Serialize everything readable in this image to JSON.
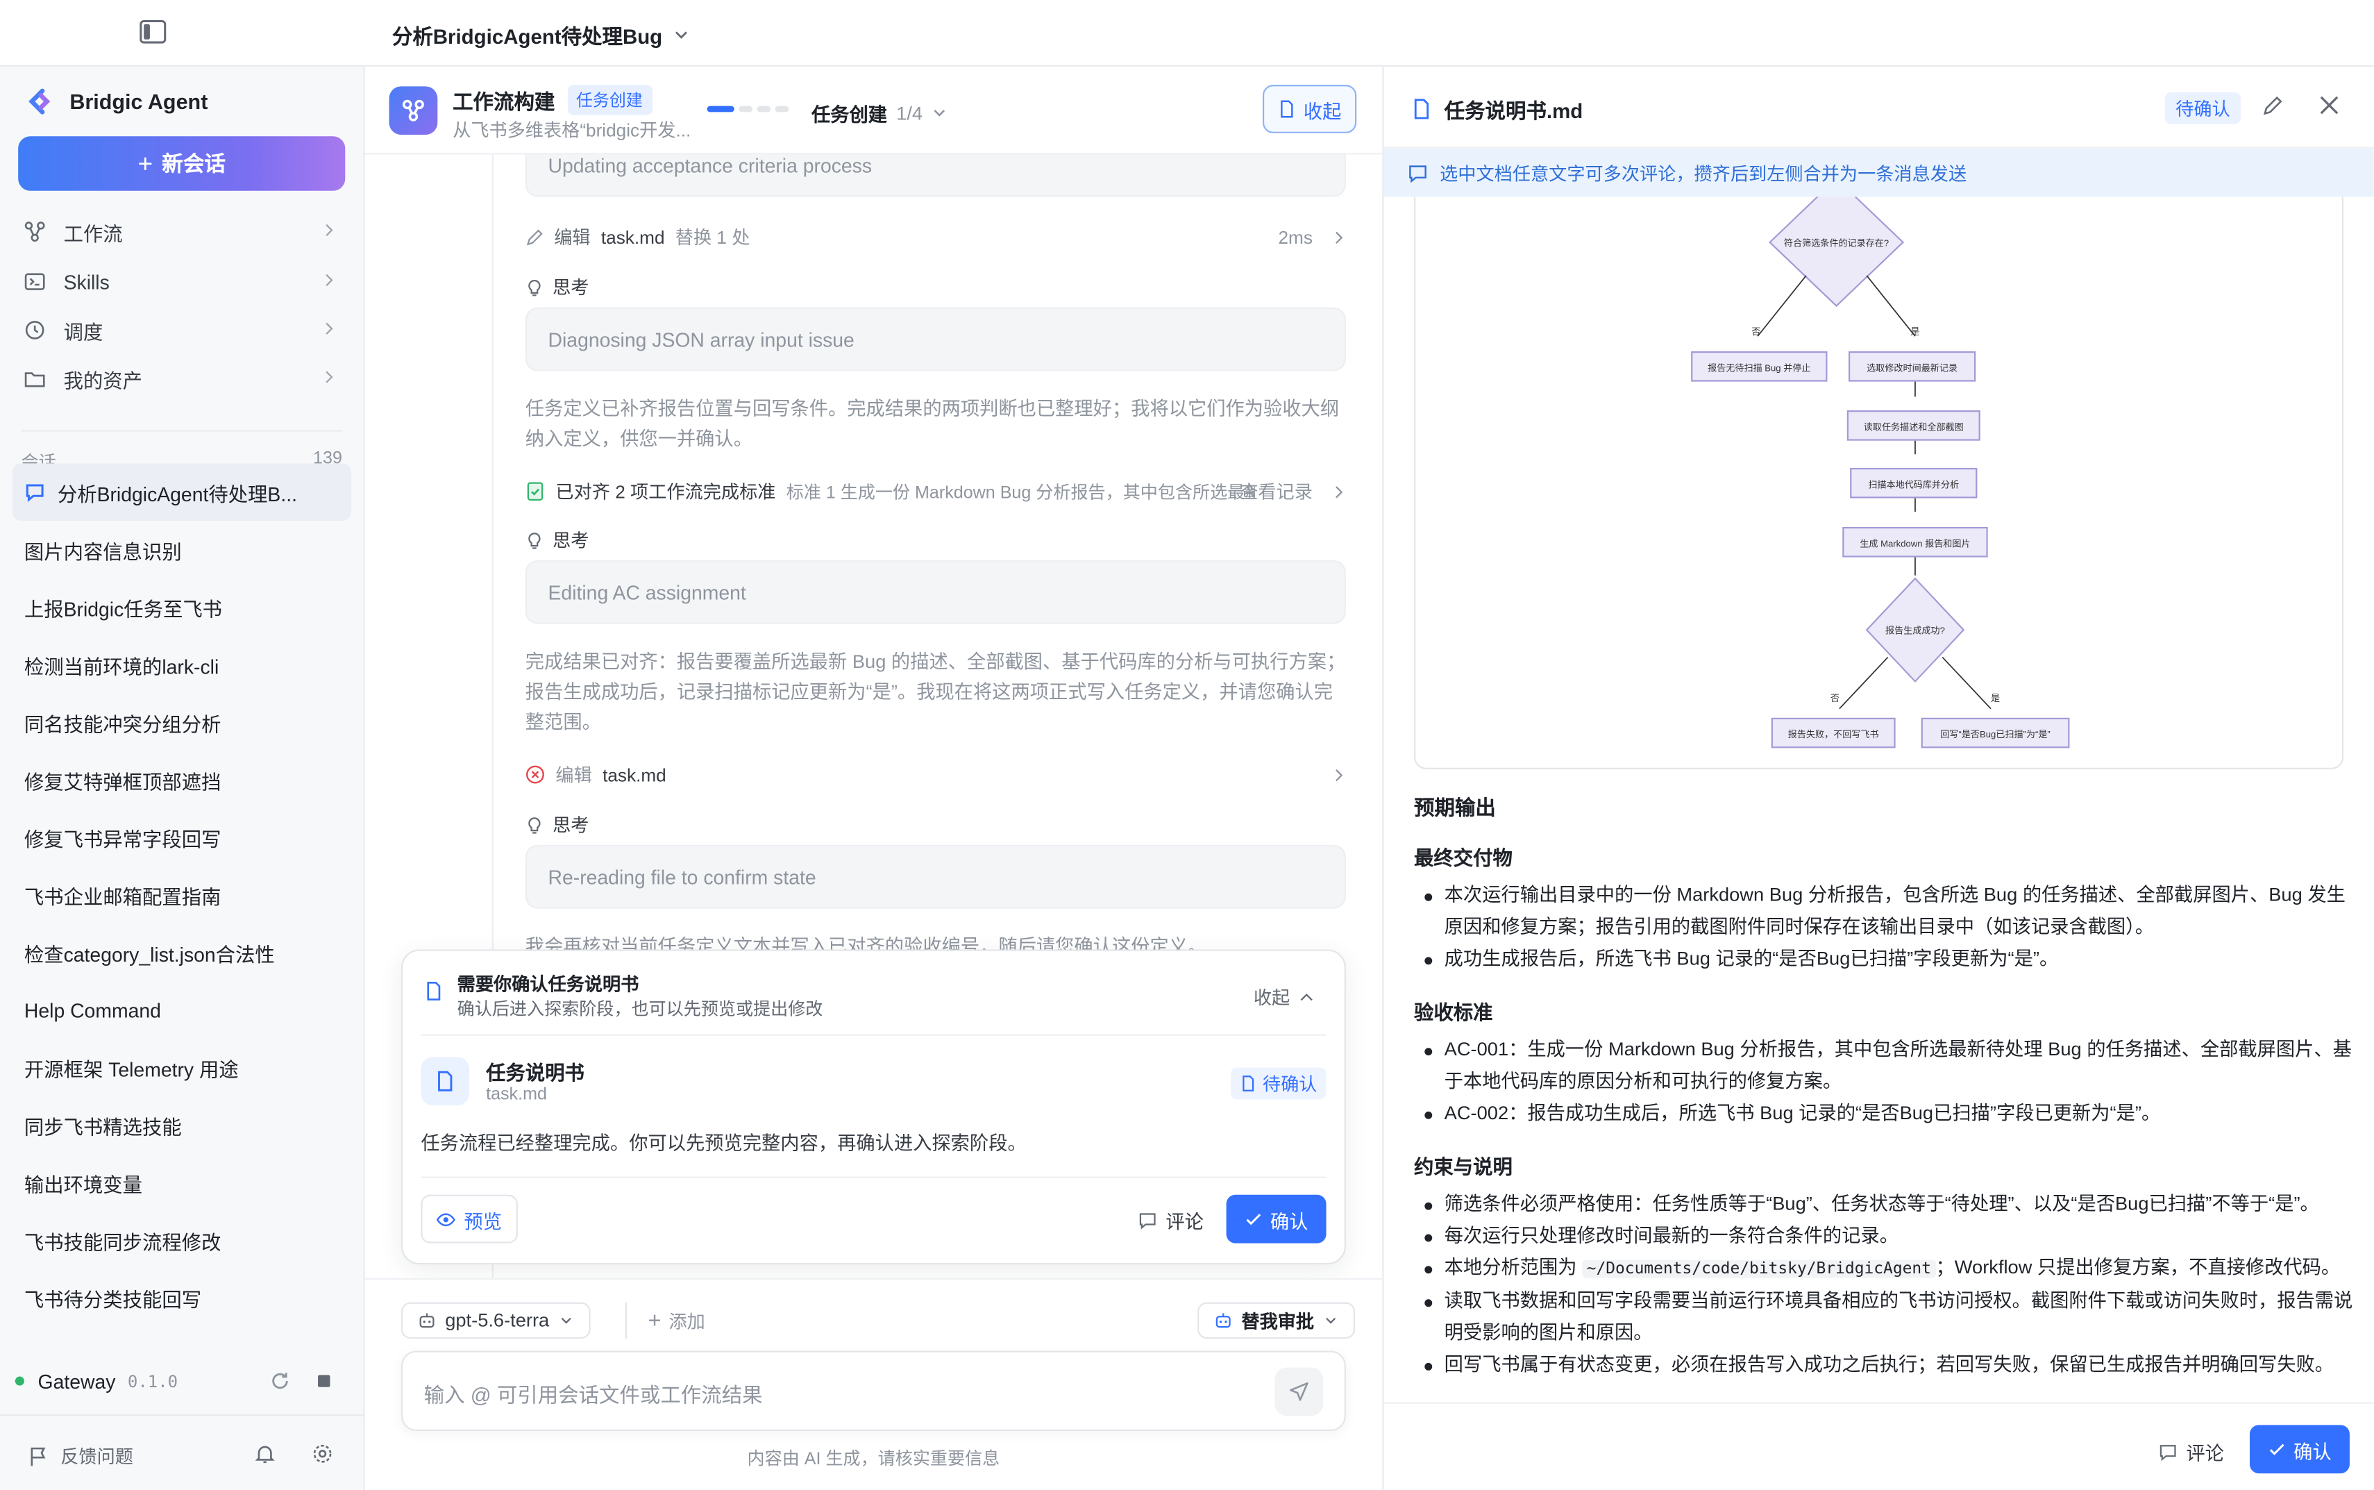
{
  "topbar": {
    "conversation_title": "分析BridgicAgent待处理Bug"
  },
  "sidebar": {
    "brand": "Bridgic Agent",
    "new_chat": "新会话",
    "nav": [
      {
        "label": "工作流",
        "icon": "workflow-icon"
      },
      {
        "label": "Skills",
        "icon": "terminal-icon"
      },
      {
        "label": "调度",
        "icon": "clock-icon"
      },
      {
        "label": "我的资产",
        "icon": "folder-icon"
      }
    ],
    "sessions_label": "会话",
    "sessions_count": "139",
    "sessions": [
      "分析BridgicAgent待处理B...",
      "图片内容信息识别",
      "上报Bridgic任务至飞书",
      "检测当前环境的lark-cli",
      "同名技能冲突分组分析",
      "修复艾特弹框顶部遮挡",
      "修复飞书异常字段回写",
      "飞书企业邮箱配置指南",
      "检查category_list.json合法性",
      "Help Command",
      "开源框架 Telemetry 用途",
      "同步飞书精选技能",
      "输出环境变量",
      "飞书技能同步流程修改",
      "飞书待分类技能回写"
    ],
    "gateway": {
      "label": "Gateway",
      "version": "0.1.0",
      "status_color": "#2fb66c"
    },
    "feedback": "反馈问题"
  },
  "workflow": {
    "title": "工作流构建",
    "badge": "任务创建",
    "subtitle": "从飞书多维表格“bridgic开发...",
    "stage": "任务创建",
    "stage_count": "1/4",
    "collapse": "收起",
    "progress": {
      "current_step": 1,
      "total_steps": 4
    }
  },
  "log": {
    "box0": "Updating acceptance criteria process",
    "edit1": {
      "action": "编辑",
      "file": "task.md",
      "detail": "替换 1 处",
      "time": "2ms"
    },
    "think_label": "思考",
    "box1": "Diagnosing JSON array input issue",
    "para1": "任务定义已补齐报告位置与回写条件。完成结果的两项判断也已整理好；我将以它们作为验收大纲纳入定义，供您一并确认。",
    "aligned": {
      "text": "已对齐 2 项工作流完成标准",
      "detail": "标准 1 生成一份 Markdown Bug 分析报告，其中包含所选最新...",
      "link": "查看记录"
    },
    "box2": "Editing AC assignment",
    "para2": "完成结果已对齐：报告要覆盖所选最新 Bug 的描述、全部截图、基于代码库的分析与可执行方案；报告生成成功后，记录扫描标记应更新为“是”。我现在将这两项正式写入任务定义，并请您确认完整范围。",
    "edit2": {
      "action": "编辑",
      "file": "task.md"
    },
    "box3": "Re-reading file to confirm state",
    "para3": "我会再核对当前任务定义文本并写入已对齐的验收编号，随后请您确认这份定义。"
  },
  "confirm_card": {
    "title": "需要你确认任务说明书",
    "subtitle": "确认后进入探索阶段，也可以先预览或提出修改",
    "collapse": "收起",
    "file_name": "任务说明书",
    "file_path": "task.md",
    "badge": "待确认",
    "description": "任务流程已经整理完成。你可以先预览完整内容，再确认进入探索阶段。",
    "preview": "预览",
    "comment": "评论",
    "confirm": "确认"
  },
  "composer": {
    "model": "gpt-5.6-terra",
    "add": "添加",
    "approval": "替我审批",
    "placeholder": "输入 @ 可引用会话文件或工作流结果",
    "disclaimer": "内容由 AI 生成，请核实重要信息"
  },
  "doc_panel": {
    "title": "任务说明书.md",
    "badge": "待确认",
    "notice": "选中文档任意文字可多次评论，攒齐后到左侧合并为一条消息发送",
    "flowchart": {
      "d1": "符合筛选条件的记录存在?",
      "no": "否",
      "yes": "是",
      "n_stop": "报告无待扫描 Bug 并停止",
      "n_pick": "选取修改时间最新记录",
      "n_read": "读取任务描述和全部截图",
      "n_scan": "扫描本地代码库并分析",
      "n_gen": "生成 Markdown 报告和图片",
      "d2": "报告生成成功?",
      "n_fail": "报告失败，不回写飞书",
      "n_write": "回写“是否Bug已扫描”为“是”"
    },
    "section_title": "预期输出",
    "final_title": "最终交付物",
    "final_items": [
      "本次运行输出目录中的一份 Markdown Bug 分析报告，包含所选 Bug 的任务描述、全部截屏图片、Bug 发生原因和修复方案；报告引用的截图附件同时保存在该输出目录中（如该记录含截图）。",
      "成功生成报告后，所选飞书 Bug 记录的“是否Bug已扫描”字段更新为“是”。"
    ],
    "ac_title": "验收标准",
    "ac_items": [
      "AC-001：生成一份 Markdown Bug 分析报告，其中包含所选最新待处理 Bug 的任务描述、全部截屏图片、基于本地代码库的原因分析和可执行的修复方案。",
      "AC-002：报告成功生成后，所选飞书 Bug 记录的“是否Bug已扫描”字段已更新为“是”。"
    ],
    "constraints_title": "约束与说明",
    "constraints": [
      "筛选条件必须严格使用：任务性质等于“Bug”、任务状态等于“待处理”、以及“是否Bug已扫描”不等于“是”。",
      "每次运行只处理修改时间最新的一条符合条件的记录。",
      {
        "pre": "本地分析范围为 ",
        "code": "~/Documents/code/bitsky/BridgicAgent",
        "post": "；Workflow 只提出修复方案，不直接修改代码。"
      },
      "读取飞书数据和回写字段需要当前运行环境具备相应的飞书访问授权。截图附件下载或访问失败时，报告需说明受影响的图片和原因。",
      "回写飞书属于有状态变更，必须在报告写入成功之后执行；若回写失败，保留已生成报告并明确回写失败。"
    ],
    "comment": "评论",
    "confirm": "确认"
  },
  "colors": {
    "accent": "#3370ff",
    "brand_gradient": [
      "#3f7df6",
      "#a779ee"
    ],
    "success": "#2fb66c",
    "error": "#e5484d"
  }
}
